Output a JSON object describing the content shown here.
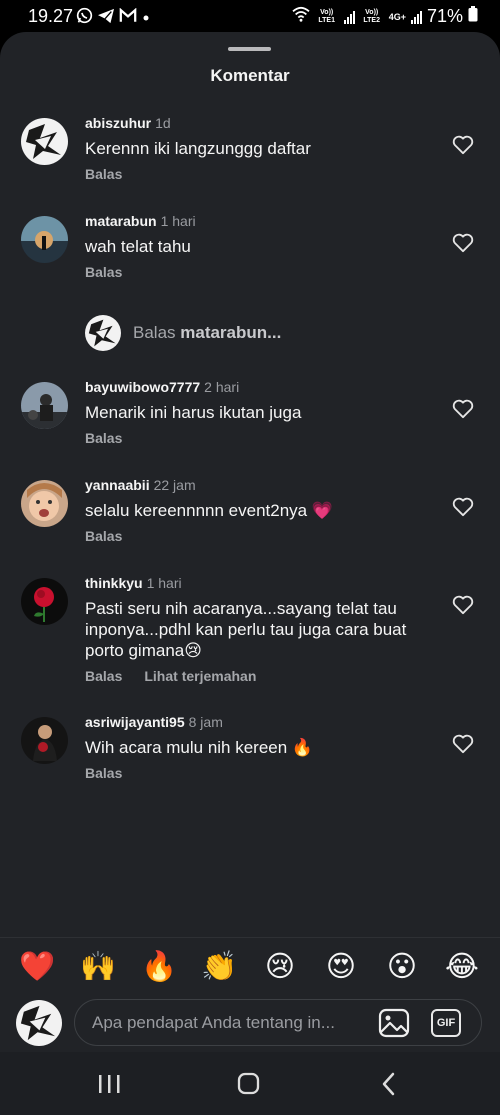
{
  "status_bar": {
    "time": "19.27",
    "app_icons": [
      "whatsapp-icon",
      "telegram-icon",
      "gmail-icon",
      "dot"
    ],
    "net1": "Vo)) LTE1",
    "net2": "Vo)) LTE2",
    "net3": "4G+",
    "battery": "71%"
  },
  "sheet": {
    "title": "Komentar"
  },
  "comments": [
    {
      "user": "abiszuhur",
      "time": "1d",
      "text": "Kerennn iki langzunggg daftar",
      "reply": "Balas"
    },
    {
      "user": "matarabun",
      "time": "1 hari",
      "text": "wah telat tahu",
      "reply": "Balas"
    },
    {
      "user": "bayuwibowo7777",
      "time": "2 hari",
      "text": "Menarik ini harus ikutan juga",
      "reply": "Balas"
    },
    {
      "user": "yannaabii",
      "time": "22 jam",
      "text": "selalu kereennnnn  event2nya 💗",
      "reply": "Balas"
    },
    {
      "user": "thinkkyu",
      "time": "1 hari",
      "text": "Pasti seru  nih acaranya...sayang telat tau inponya...pdhl kan perlu tau juga cara buat porto gimana😢",
      "reply": "Balas",
      "translate": "Lihat terjemahan"
    },
    {
      "user": "asriwijayanti95",
      "time": "8 jam",
      "text": "Wih acara mulu nih kereen 🔥",
      "reply": "Balas"
    }
  ],
  "reply_prompt": {
    "prefix": "Balas ",
    "target": "matarabun..."
  },
  "quick_emojis": [
    "❤️",
    "🙌",
    "🔥",
    "👏",
    "😢",
    "😍",
    "😮",
    "😂"
  ],
  "composer": {
    "placeholder": "Apa pendapat Anda tentang in...",
    "gif_label": "GIF"
  },
  "colors": {
    "sheet_bg": "#212327",
    "secondary_text": "#9a9ca1",
    "nav_bg": "#1d1f23"
  }
}
